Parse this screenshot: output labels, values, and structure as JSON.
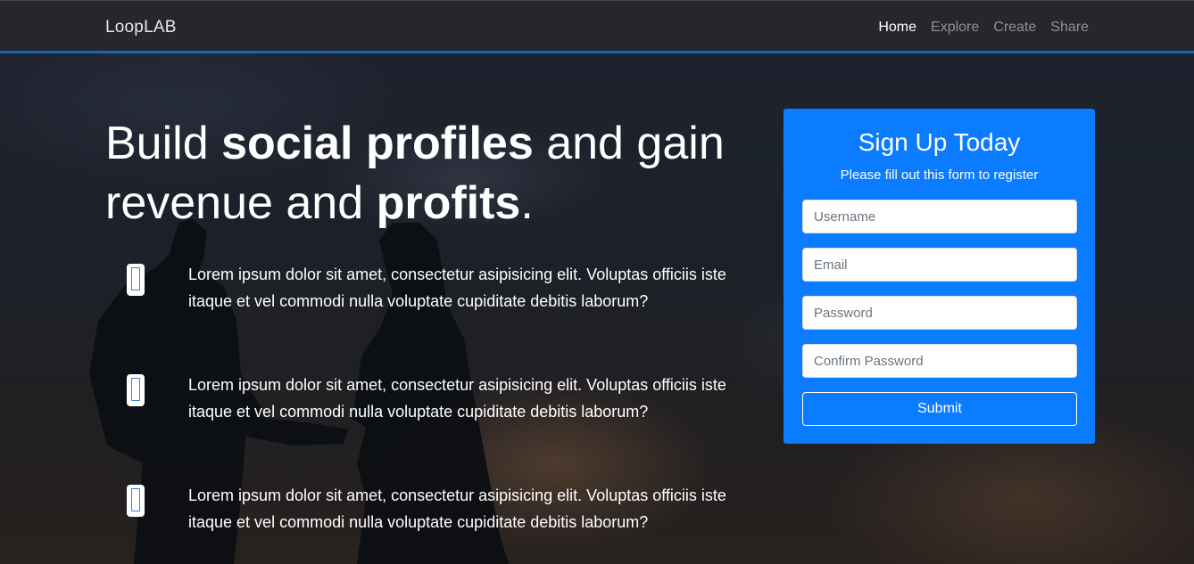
{
  "navbar": {
    "brand": "LoopLAB",
    "links": [
      {
        "label": "Home",
        "active": true
      },
      {
        "label": "Explore",
        "active": false
      },
      {
        "label": "Create",
        "active": false
      },
      {
        "label": "Share",
        "active": false
      }
    ]
  },
  "hero": {
    "headline_parts": [
      {
        "text": "Build ",
        "bold": false
      },
      {
        "text": "social profiles",
        "bold": true
      },
      {
        "text": " and gain revenue and ",
        "bold": false
      },
      {
        "text": "profits",
        "bold": true
      },
      {
        "text": ".",
        "bold": false
      }
    ],
    "features": [
      {
        "icon": "mobile-icon",
        "text": "Lorem ipsum dolor sit amet, consectetur asipisicing elit. Voluptas officiis iste itaque et vel commodi nulla voluptate cupiditate debitis laborum?"
      },
      {
        "icon": "mobile-icon",
        "text": "Lorem ipsum dolor sit amet, consectetur asipisicing elit. Voluptas officiis iste itaque et vel commodi nulla voluptate cupiditate debitis laborum?"
      },
      {
        "icon": "mobile-icon",
        "text": "Lorem ipsum dolor sit amet, consectetur asipisicing elit. Voluptas officiis iste itaque et vel commodi nulla voluptate cupiditate debitis laborum?"
      }
    ]
  },
  "signup": {
    "title": "Sign Up Today",
    "subtitle": "Please fill out this form to register",
    "fields": {
      "username_placeholder": "Username",
      "email_placeholder": "Email",
      "password_placeholder": "Password",
      "confirm_placeholder": "Confirm Password"
    },
    "submit_label": "Submit",
    "card_color": "#0b7bff"
  },
  "colors": {
    "navbar_bg": "#25272a",
    "navbar_accent": "#1565b8"
  }
}
